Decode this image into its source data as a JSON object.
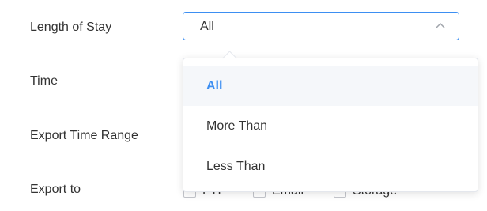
{
  "form": {
    "labels": {
      "length_of_stay": "Length of Stay",
      "time": "Time",
      "export_time_range": "Export Time Range",
      "export_to": "Export to"
    },
    "length_of_stay_select": {
      "value": "All",
      "icon": "chevron-up-icon",
      "options": [
        {
          "label": "All",
          "selected": true
        },
        {
          "label": "More Than",
          "selected": false
        },
        {
          "label": "Less Than",
          "selected": false
        }
      ]
    },
    "export_to_options": [
      "FTP",
      "Email",
      "Storage"
    ]
  },
  "colors": {
    "accent": "#3d8ff2",
    "text": "#333333",
    "border": "#e4e7ed",
    "hover_bg": "#f5f7fa"
  }
}
